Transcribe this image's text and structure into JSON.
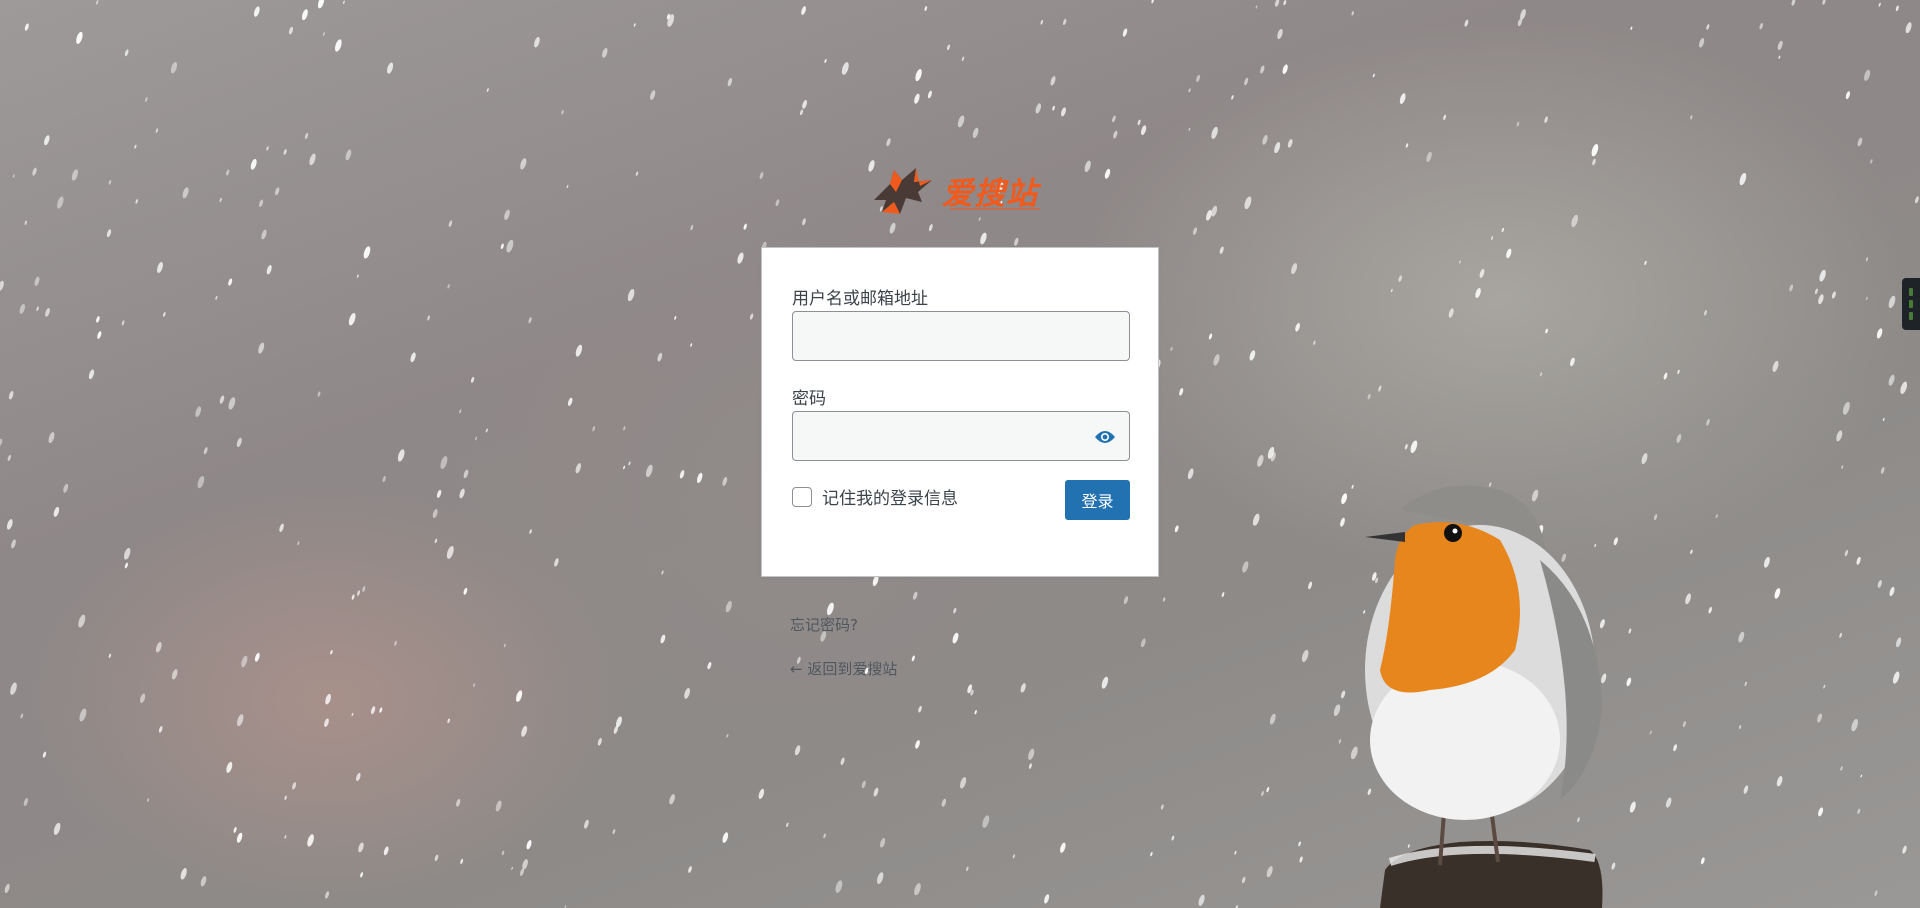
{
  "brand": {
    "name": "爱搜站",
    "logo_color": "#f05a1c"
  },
  "form": {
    "username_label": "用户名或邮箱地址",
    "username_value": "",
    "password_label": "密码",
    "password_value": "",
    "remember_label": "记住我的登录信息",
    "remember_checked": false,
    "login_button": "登录",
    "show_password_icon": "eye-icon",
    "accent_color": "#2271b1"
  },
  "links": {
    "lost_password": "忘记密码?",
    "back_to_site": "← 返回到爱搜站"
  }
}
